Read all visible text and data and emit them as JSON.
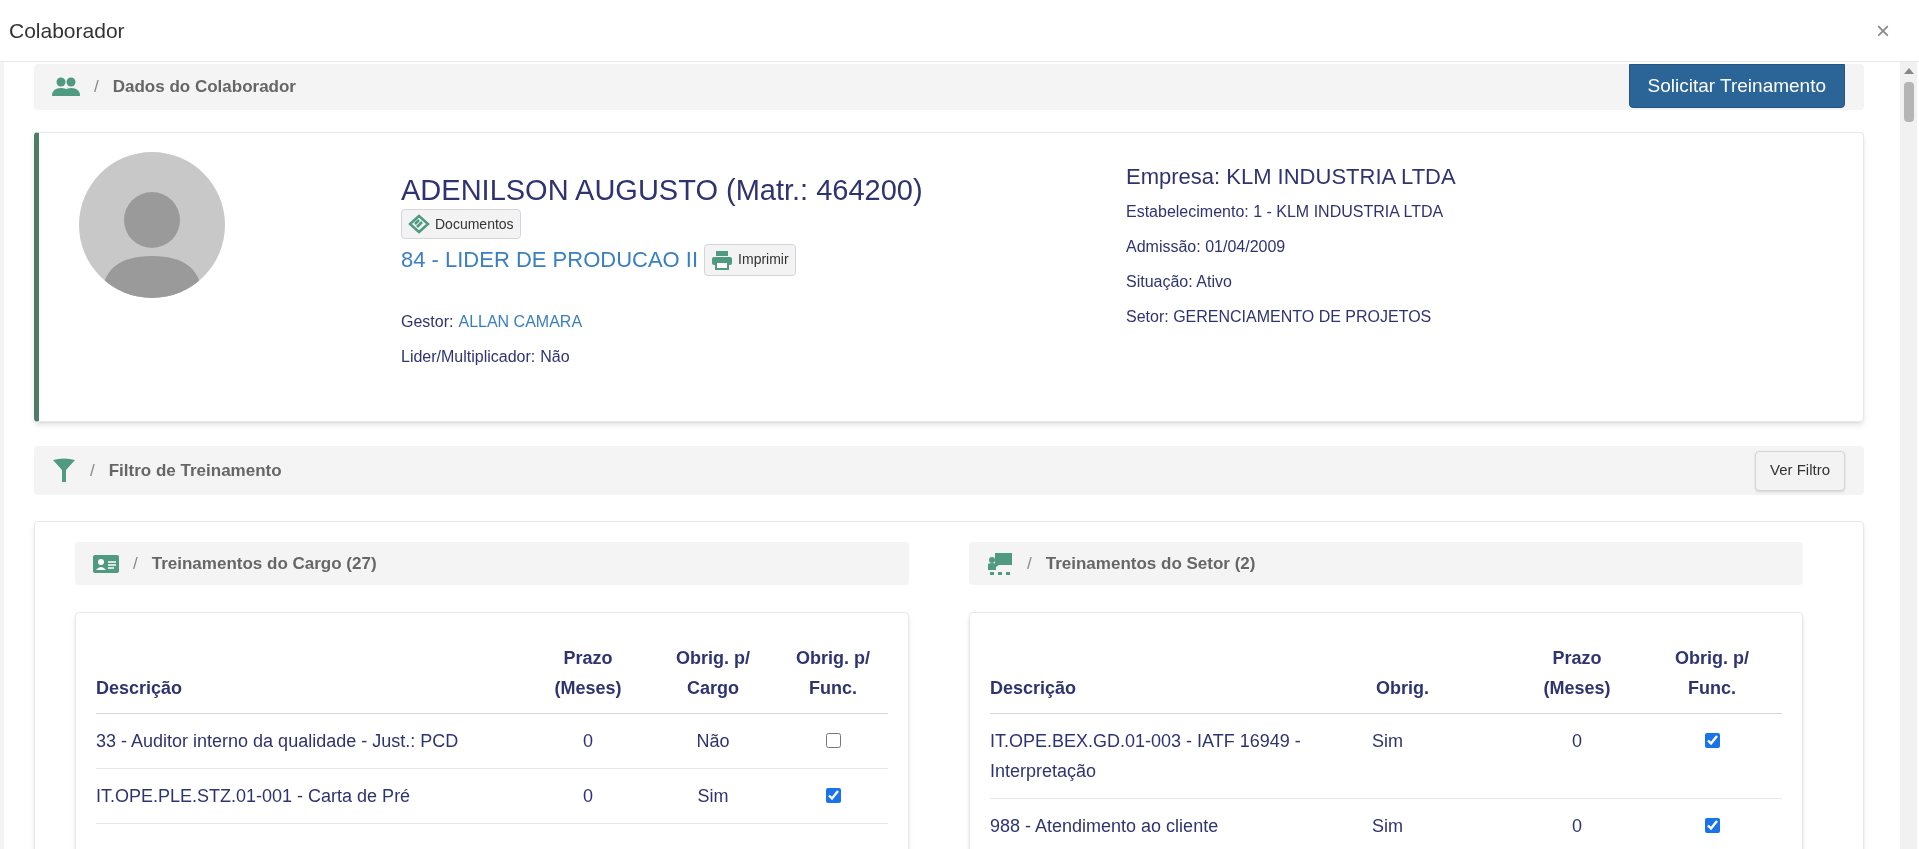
{
  "window": {
    "title": "Colaborador",
    "close": "×"
  },
  "header": {
    "separator": "/",
    "title": "Dados do Colaborador",
    "button": "Solicitar Treinamento"
  },
  "employee": {
    "name": "ADENILSON AUGUSTO (Matr.: 464200)",
    "documents_button": "Documentos",
    "role": "84 - LIDER DE PRODUCAO II",
    "print_button": "Imprimir",
    "details_left": [
      {
        "label": "Gestor:",
        "value": "ALLAN CAMARA",
        "kind": "link"
      },
      {
        "label": "Lider/Multiplicador:",
        "value": "Não",
        "kind": "text"
      }
    ],
    "company": "Empresa: KLM INDUSTRIA LTDA",
    "details_right": [
      "Estabelecimento: 1 - KLM INDUSTRIA LTDA",
      "Admissão: 01/04/2009",
      "Situação: Ativo",
      "Setor: GERENCIAMENTO DE PROJETOS"
    ]
  },
  "filter": {
    "separator": "/",
    "title": "Filtro de Treinamento",
    "button": "Ver Filtro"
  },
  "panels": [
    {
      "separator": "/",
      "title": "Treinamentos do Cargo (27)",
      "kind": "cargo",
      "columns": [
        "Descrição",
        "Prazo\n(Meses)",
        "Obrig. p/\nCargo",
        "Obrig. p/\nFunc."
      ],
      "rows": [
        {
          "description": "33 - Auditor interno da qualidade - Just.: PCD",
          "col_2": "0",
          "col_3": "Não",
          "checked": false
        },
        {
          "description": "IT.OPE.PLE.STZ.01-001 - Carta de Pré",
          "col_2": "0",
          "col_3": "Sim",
          "checked": true
        }
      ]
    },
    {
      "separator": "/",
      "title": "Treinamentos do Setor (2)",
      "kind": "setor",
      "columns": [
        "Descrição",
        "Obrig.",
        "Prazo\n(Meses)",
        "Obrig. p/\nFunc."
      ],
      "rows": [
        {
          "description": "IT.OPE.BEX.GD.01-003 - IATF 16949 - Interpretação",
          "col_2": "Sim",
          "col_3": "0",
          "checked": true
        },
        {
          "description": "988 - Atendimento ao cliente",
          "col_2": "Sim",
          "col_3": "0",
          "checked": true
        }
      ]
    }
  ]
}
